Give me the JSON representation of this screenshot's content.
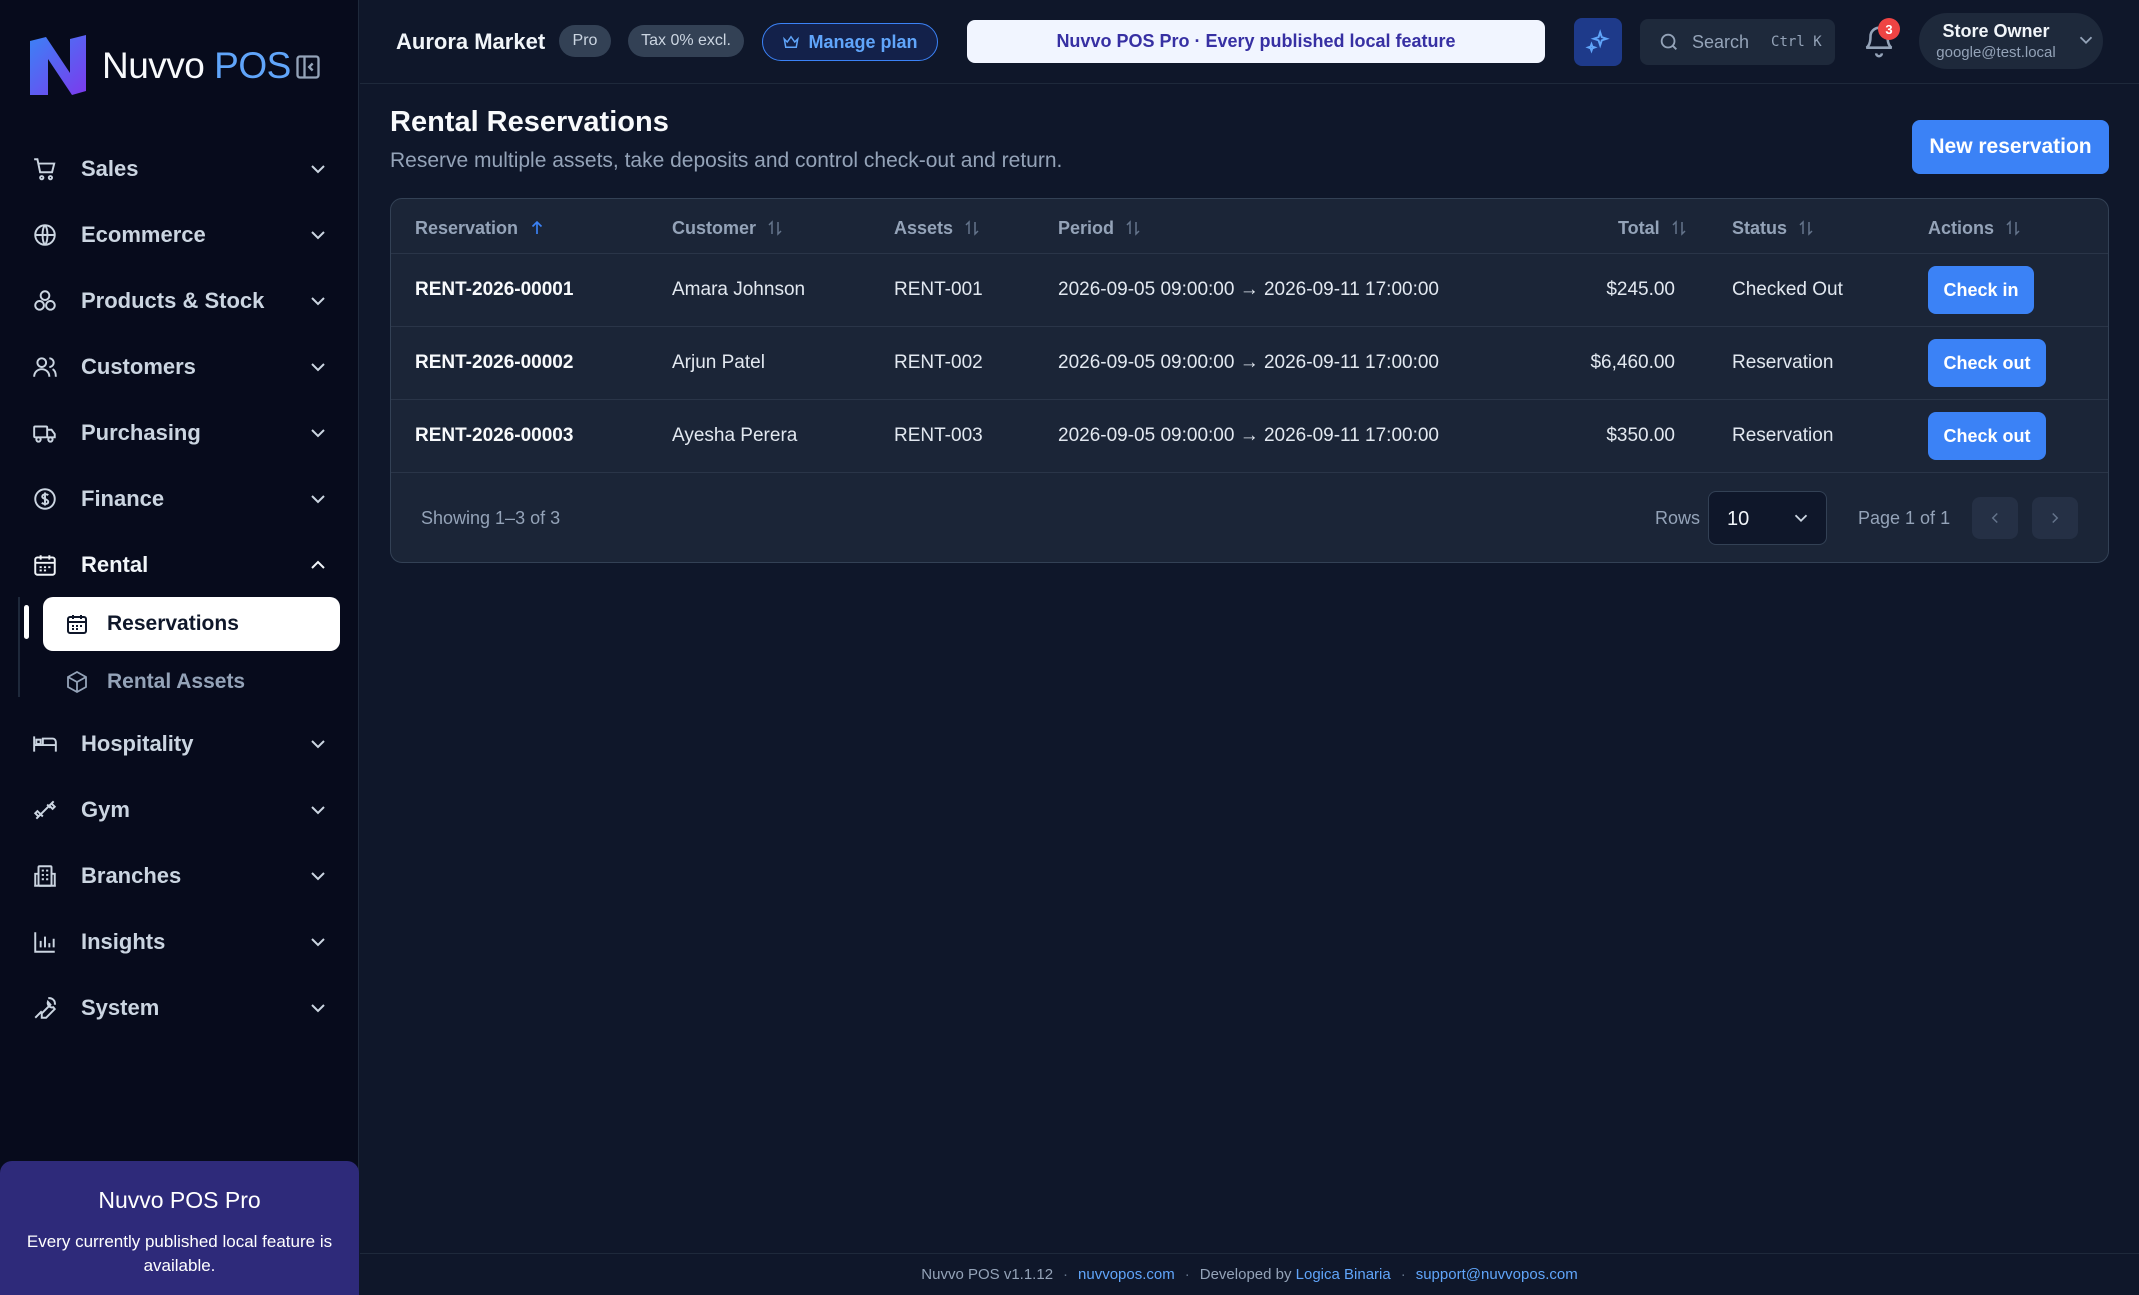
{
  "app": {
    "logo_text": "Nuvvo",
    "logo_suffix": "POS"
  },
  "sidebar": {
    "items": [
      {
        "label": "Sales",
        "icon": "cart-icon"
      },
      {
        "label": "Ecommerce",
        "icon": "globe-icon"
      },
      {
        "label": "Products & Stock",
        "icon": "boxes-icon"
      },
      {
        "label": "Customers",
        "icon": "users-icon"
      },
      {
        "label": "Purchasing",
        "icon": "truck-icon"
      },
      {
        "label": "Finance",
        "icon": "dollar-icon"
      },
      {
        "label": "Rental",
        "icon": "calendar-icon"
      },
      {
        "label": "Hospitality",
        "icon": "bed-icon"
      },
      {
        "label": "Gym",
        "icon": "dumbbell-icon"
      },
      {
        "label": "Branches",
        "icon": "building-icon"
      },
      {
        "label": "Insights",
        "icon": "bar-chart-icon"
      },
      {
        "label": "System",
        "icon": "wrench-icon"
      }
    ],
    "rental_sub": [
      {
        "label": "Reservations",
        "icon": "calendar-icon"
      },
      {
        "label": "Rental Assets",
        "icon": "box-icon"
      }
    ],
    "promo": {
      "title": "Nuvvo POS Pro",
      "desc": "Every currently published local feature is available."
    }
  },
  "topbar": {
    "store_name": "Aurora Market",
    "plan_badge": "Pro",
    "tax_badge": "Tax 0% excl.",
    "manage_plan": "Manage plan",
    "banner": "Nuvvo POS Pro · Every published local feature",
    "search_label": "Search",
    "search_shortcut": "Ctrl K",
    "notification_count": "3",
    "user_name": "Store Owner",
    "user_email": "google@test.local"
  },
  "page": {
    "title": "Rental Reservations",
    "subtitle": "Reserve multiple assets, take deposits and control check-out and return.",
    "new_button": "New reservation"
  },
  "table": {
    "columns": [
      "Reservation",
      "Customer",
      "Assets",
      "Period",
      "Total",
      "Status",
      "Actions"
    ],
    "rows": [
      {
        "id": "RENT-2026-00001",
        "customer": "Amara Johnson",
        "assets": "RENT-001",
        "period": "2026-09-05 09:00:00 → 2026-09-11 17:00:00",
        "total": "$245.00",
        "status": "Checked Out",
        "action": "Check in"
      },
      {
        "id": "RENT-2026-00002",
        "customer": "Arjun Patel",
        "assets": "RENT-002",
        "period": "2026-09-05 09:00:00 → 2026-09-11 17:00:00",
        "total": "$6,460.00",
        "status": "Reservation",
        "action": "Check out"
      },
      {
        "id": "RENT-2026-00003",
        "customer": "Ayesha Perera",
        "assets": "RENT-003",
        "period": "2026-09-05 09:00:00 → 2026-09-11 17:00:00",
        "total": "$350.00",
        "status": "Reservation",
        "action": "Check out"
      }
    ],
    "showing": "Showing 1–3 of 3",
    "rows_label": "Rows",
    "rows_value": "10",
    "page_info": "Page 1 of 1"
  },
  "footer": {
    "version": "Nuvvo POS v1.1.12",
    "site": "nuvvopos.com",
    "developed_by": "Developed by",
    "developer": "Logica Binaria",
    "support": "support@nuvvopos.com"
  },
  "colors": {
    "accent": "#3b82f6",
    "background": "#0f172a",
    "sidebar": "#070b1c",
    "card": "#1b2537",
    "promo": "#2e2a7a",
    "badge": "#ef4444"
  }
}
